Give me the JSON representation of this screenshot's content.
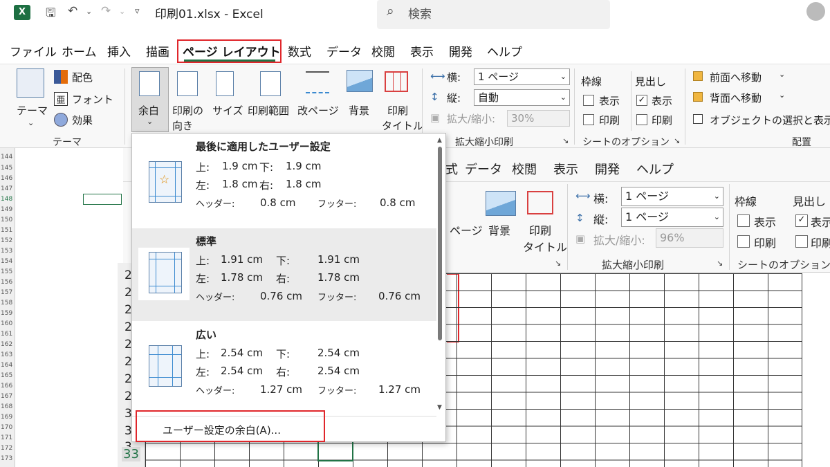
{
  "window": {
    "title": "印刷01.xlsx  -  Excel",
    "app_icon": "X"
  },
  "search": {
    "placeholder": "検索"
  },
  "tabs": [
    "ファイル",
    "ホーム",
    "挿入",
    "描画",
    "ページ レイアウト",
    "数式",
    "データ",
    "校閲",
    "表示",
    "開発",
    "ヘルプ"
  ],
  "active_tab": "ページ レイアウト",
  "ribbon": {
    "theme": {
      "label": "テーマ",
      "colors": "配色",
      "fonts": "フォント",
      "effects": "効果",
      "group": "テーマ"
    },
    "margins": "余白",
    "orientation": {
      "line1": "印刷の",
      "line2": "向き"
    },
    "size": "サイズ",
    "print_area": "印刷範囲",
    "breaks": "改ページ",
    "background": "背景",
    "print_titles": {
      "line1": "印刷",
      "line2": "タイトル"
    },
    "scale": {
      "width_label": "横:",
      "width_value": "1 ページ",
      "height_label": "縦:",
      "height_value": "自動",
      "scale_label": "拡大/縮小:",
      "scale_value": "30%",
      "group": "拡大縮小印刷"
    },
    "sheet_options": {
      "gridlines": "枠線",
      "headings": "見出し",
      "view": "表示",
      "print": "印刷",
      "group": "シートのオプション"
    },
    "arrange": {
      "bring_forward": "前面へ移動",
      "send_backward": "背面へ移動",
      "selection_pane": "オブジェクトの選択と表示",
      "group": "配置"
    }
  },
  "inner": {
    "tabs": [
      "式",
      "データ",
      "校閲",
      "表示",
      "開発",
      "ヘルプ"
    ],
    "width_value": "1 ページ",
    "height_value": "1 ページ",
    "scale_value": "96%",
    "breaks_partial": "ページ"
  },
  "row_numbers": [
    "144",
    "145",
    "146",
    "147",
    "148",
    "149",
    "150",
    "151",
    "152",
    "153",
    "154",
    "155",
    "156",
    "157",
    "158",
    "159",
    "160",
    "161",
    "162",
    "163",
    "164",
    "165",
    "166",
    "167",
    "168",
    "169",
    "170",
    "171",
    "172",
    "173"
  ],
  "inner_rows": [
    "2",
    "2",
    "2",
    "2",
    "2",
    "2",
    "2",
    "2",
    "3",
    "3",
    "3",
    "33"
  ],
  "margins_menu": {
    "items": [
      {
        "title": "最後に適用したユーザー設定",
        "top": "上:",
        "top_v": "1.9 cm",
        "bottom": "下:",
        "bottom_v": "1.9 cm",
        "left": "左:",
        "left_v": "1.8 cm",
        "right": "右:",
        "right_v": "1.8 cm",
        "header": "ヘッダー:",
        "header_v": "0.8 cm",
        "footer": "フッター:",
        "footer_v": "0.8 cm"
      },
      {
        "title": "標準",
        "top": "上:",
        "top_v": "1.91 cm",
        "bottom": "下:",
        "bottom_v": "1.91 cm",
        "left": "左:",
        "left_v": "1.78 cm",
        "right": "右:",
        "right_v": "1.78 cm",
        "header": "ヘッダー:",
        "header_v": "0.76 cm",
        "footer": "フッター:",
        "footer_v": "0.76 cm"
      },
      {
        "title": "広い",
        "top": "上:",
        "top_v": "2.54 cm",
        "bottom": "下:",
        "bottom_v": "2.54 cm",
        "left": "左:",
        "left_v": "2.54 cm",
        "right": "右:",
        "right_v": "2.54 cm",
        "header": "ヘッダー:",
        "header_v": "1.27 cm",
        "footer": "フッター:",
        "footer_v": "1.27 cm"
      }
    ],
    "custom": "ユーザー設定の余白(A)..."
  },
  "colors": {
    "accent": "#217346",
    "highlight": "#e0262b"
  }
}
